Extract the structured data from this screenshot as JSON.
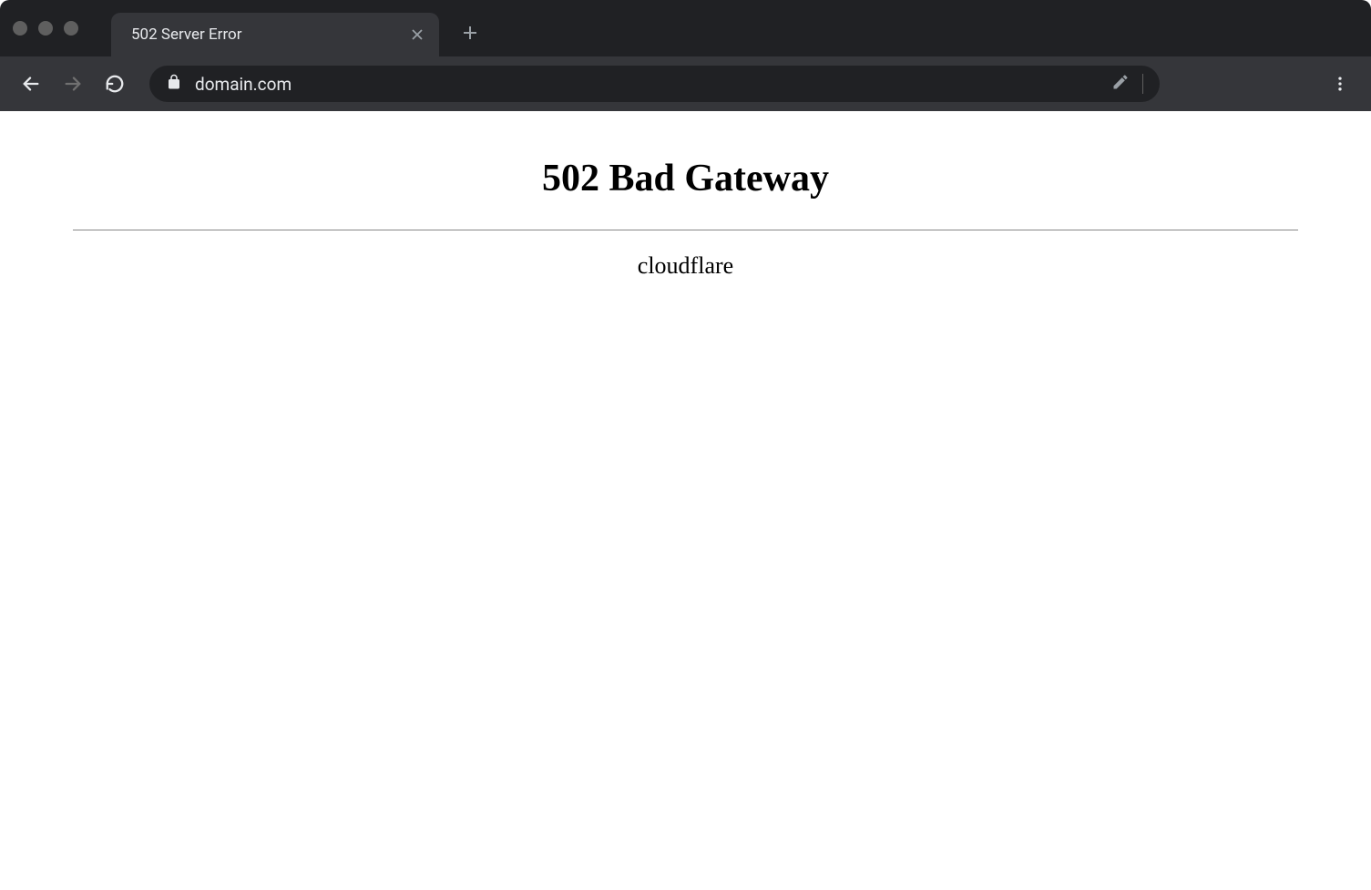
{
  "browser": {
    "tab": {
      "title": "502 Server Error"
    },
    "address_bar": {
      "url": "domain.com"
    }
  },
  "page": {
    "heading": "502 Bad Gateway",
    "server": "cloudflare"
  }
}
